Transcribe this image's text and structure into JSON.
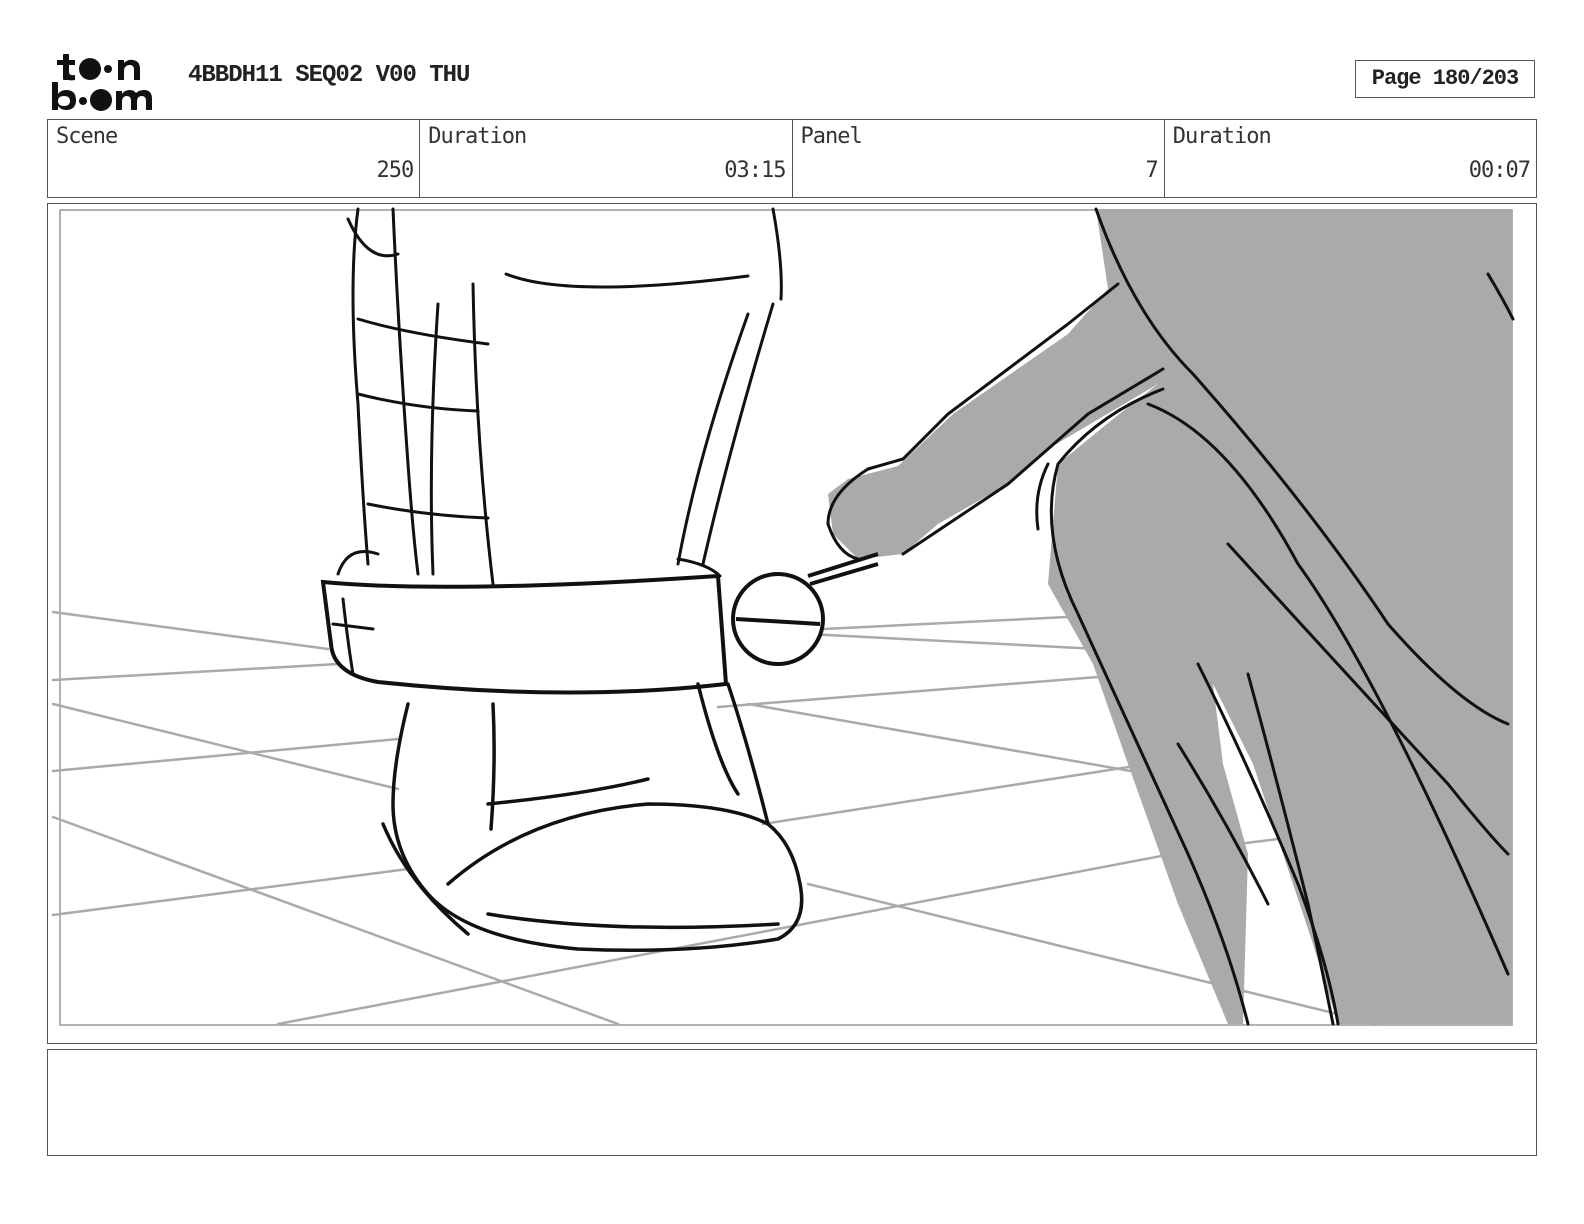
{
  "header": {
    "logo_text_top": "toon",
    "logo_text_bottom": "boom",
    "title": "4BBDH11 SEQ02 V00 THU",
    "page": "Page 180/203"
  },
  "info": {
    "scene_label": "Scene",
    "scene_value": "250",
    "scene_duration_label": "Duration",
    "scene_duration_value": "03:15",
    "panel_label": "Panel",
    "panel_value": "7",
    "panel_duration_label": "Duration",
    "panel_duration_value": "00:07"
  },
  "panel_image": {
    "description_icon": "storyboard-sketch",
    "shade_color": "#aaaaaa",
    "line_color": "#111111",
    "floor_color": "#aaaaaa"
  },
  "notes": {
    "text": ""
  }
}
